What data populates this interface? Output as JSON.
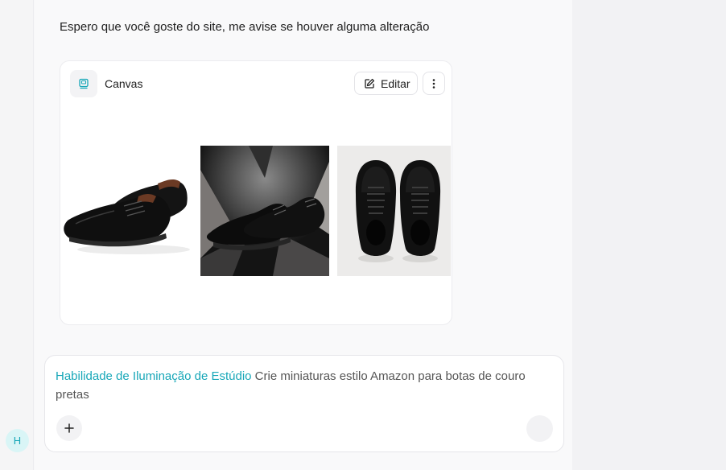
{
  "sidebar": {
    "avatar_initial": "H"
  },
  "chat": {
    "message": "Espero que você goste do site, me avise se houver alguma alteração"
  },
  "canvas": {
    "title": "Canvas",
    "icon": "canvas-icon",
    "edit_label": "Editar",
    "edit_icon": "edit-icon",
    "more_icon": "more-vertical-icon",
    "images": [
      {
        "name": "black-oxford-shoes-white-background"
      },
      {
        "name": "black-shoes-dark-geometric-background"
      },
      {
        "name": "black-sneakers-top-view"
      }
    ]
  },
  "composer": {
    "skill_tag": "Habilidade de Iluminação de Estúdio",
    "prompt_text": "Crie miniaturas estilo Amazon para botas de couro pretas",
    "add_icon": "plus-icon",
    "send_icon": "send-icon"
  },
  "colors": {
    "accent": "#17a7b8"
  }
}
